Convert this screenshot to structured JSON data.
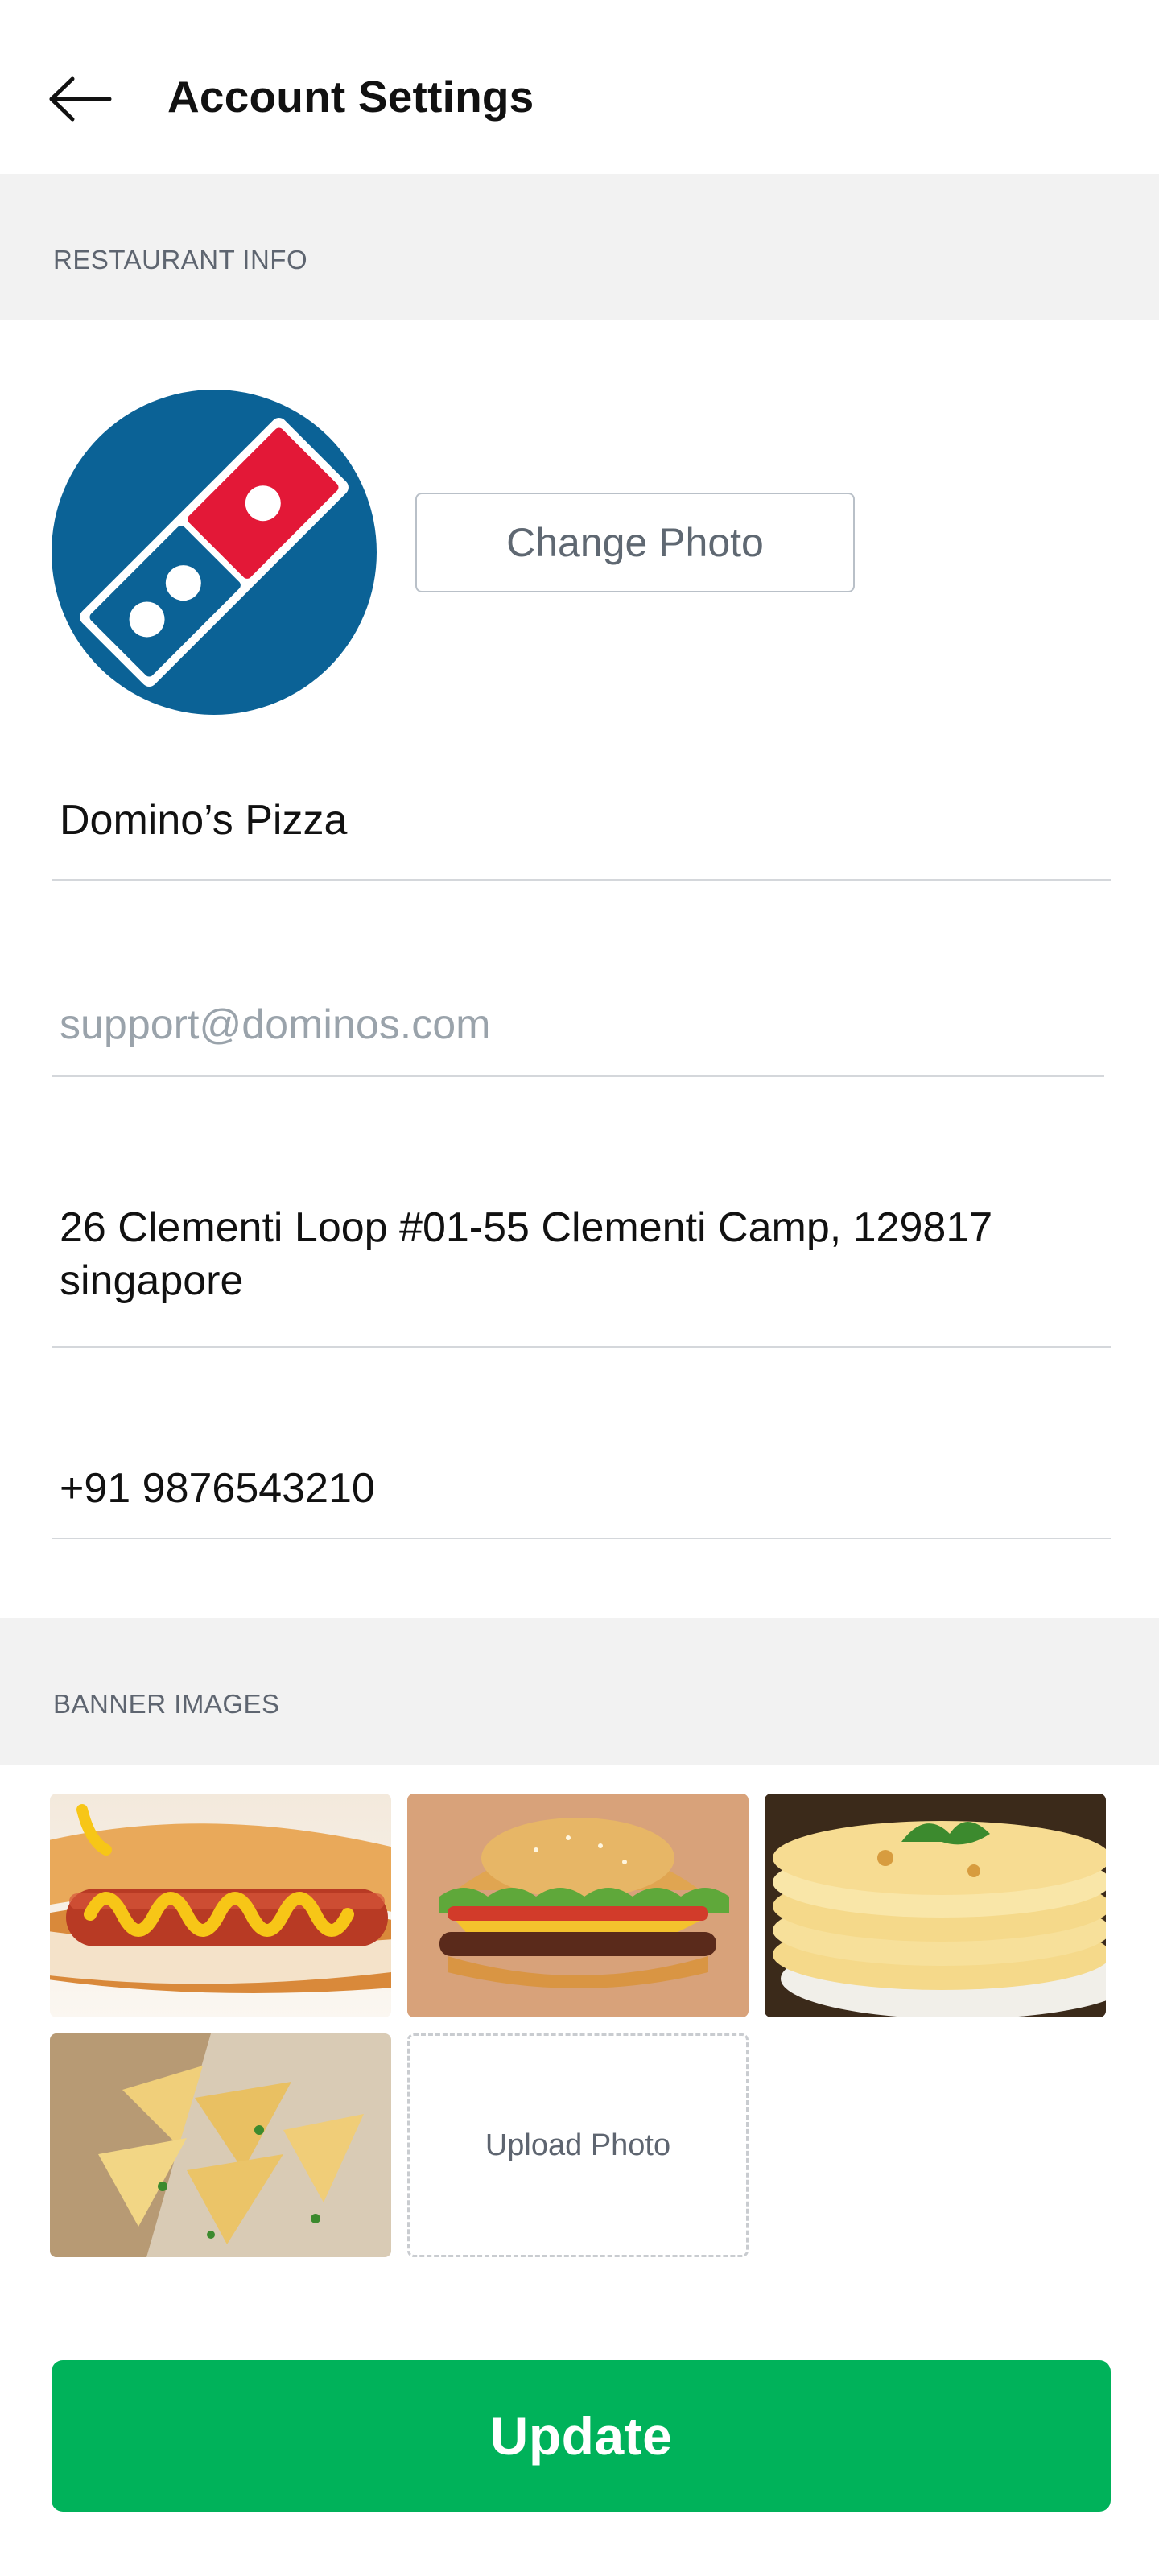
{
  "header": {
    "title": "Account Settings",
    "back_icon": "arrow-left-icon"
  },
  "sections": {
    "restaurant_info": "RESTAURANT INFO",
    "banner_images": "BANNER IMAGES"
  },
  "profile": {
    "logo_icon": "dominos-logo",
    "change_photo_label": "Change Photo"
  },
  "fields": {
    "name": "Domino’s Pizza",
    "email_placeholder": "support@dominos.com",
    "address_line1": "26 Clementi Loop #01-55 Clementi Camp, 129817",
    "address_line2": "singapore",
    "phone": "+91 9876543210"
  },
  "banner": {
    "images": [
      "hot-dog-image",
      "burger-image",
      "flatbread-image",
      "samosa-image"
    ],
    "upload_label": "Upload Photo"
  },
  "actions": {
    "update_label": "Update"
  },
  "colors": {
    "accent_green": "#00b25a",
    "logo_blue": "#0b6296",
    "logo_red": "#e31837"
  }
}
